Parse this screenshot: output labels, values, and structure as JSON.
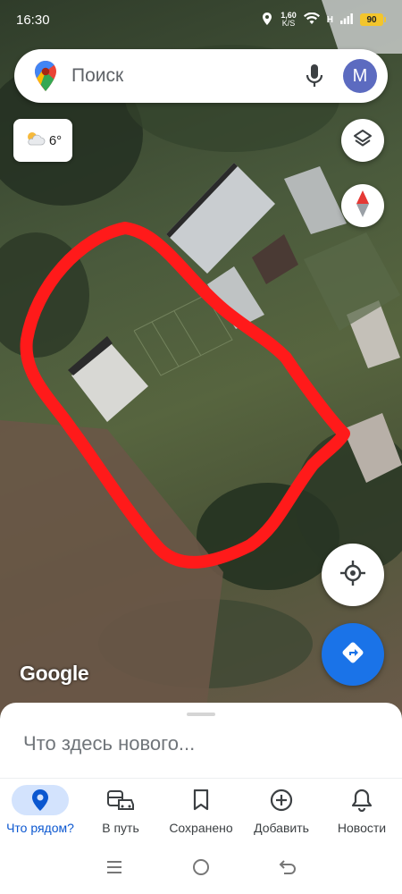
{
  "status_bar": {
    "time": "16:30",
    "speed_value": "1,60",
    "speed_unit": "K/S",
    "network": "H",
    "battery": "90"
  },
  "search": {
    "placeholder": "Поиск",
    "avatar_letter": "M"
  },
  "weather": {
    "temperature": "6°",
    "icon": "partly-cloudy-icon"
  },
  "map": {
    "attribution": "Google",
    "annotation_color": "#ff1a1a"
  },
  "bottom_sheet": {
    "prompt": "Что здесь нового..."
  },
  "bottom_nav": {
    "items": [
      {
        "label": "Что рядом?",
        "icon": "location-pin-icon",
        "active": true
      },
      {
        "label": "В путь",
        "icon": "commute-icon",
        "active": false
      },
      {
        "label": "Сохранено",
        "icon": "bookmark-icon",
        "active": false
      },
      {
        "label": "Добавить",
        "icon": "add-circle-icon",
        "active": false
      },
      {
        "label": "Новости",
        "icon": "bell-icon",
        "active": false
      }
    ]
  },
  "colors": {
    "accent": "#1a73e8",
    "active_nav": "#0b57d0",
    "active_nav_bg": "#d3e3fd",
    "battery": "#f3c52c"
  }
}
